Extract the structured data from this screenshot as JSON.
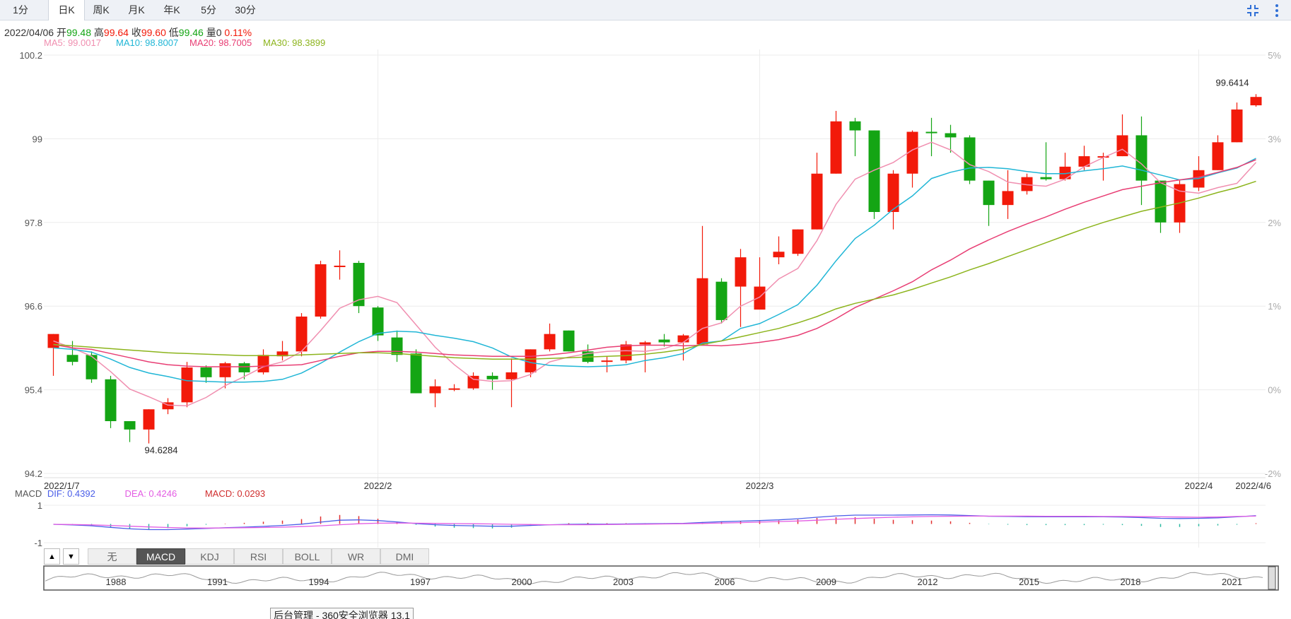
{
  "tabs": [
    "1分",
    "日K",
    "周K",
    "月K",
    "年K",
    "5分",
    "30分"
  ],
  "active_tab": "日K",
  "info": {
    "date": "2022/04/06",
    "open_label": "开",
    "open": "99.48",
    "high_label": "高",
    "high": "99.64",
    "close_label": "收",
    "close": "99.60",
    "low_label": "低",
    "low": "99.46",
    "vol_label": "量",
    "vol": "0",
    "change": "0.11%"
  },
  "ma": [
    {
      "label": "MA5: 99.0017",
      "color": "#f08fb0"
    },
    {
      "label": "MA10: 98.8007",
      "color": "#20b6d6"
    },
    {
      "label": "MA20: 98.7005",
      "color": "#e83e74"
    },
    {
      "label": "MA30: 98.3899",
      "color": "#8cb41c"
    }
  ],
  "macd_legend": {
    "name": "MACD",
    "dif": "DIF: 0.4392",
    "dea": "DEA: 0.4246",
    "macd": "MACD: 0.0293"
  },
  "indicator_tabs": [
    "无",
    "MACD",
    "KDJ",
    "RSI",
    "BOLL",
    "WR",
    "DMI"
  ],
  "active_indicator": "MACD",
  "arrows": {
    "up": "▲",
    "down": "▼"
  },
  "navigator_years": [
    "1988",
    "1991",
    "1994",
    "1997",
    "2000",
    "2003",
    "2006",
    "2009",
    "2012",
    "2015",
    "2018",
    "2021"
  ],
  "tooltip": "后台管理 - 360安全浏览器 13.1",
  "colors": {
    "up": "#f21a0a",
    "down": "#14a514",
    "dif": "#4a5ee8",
    "dea": "#e35ce3",
    "hist_up": "#e03030",
    "hist_down": "#2ab8a0"
  },
  "chart_data": {
    "type": "candlestick",
    "y_ticks": [
      "100.2",
      "99",
      "97.8",
      "96.6",
      "95.4",
      "94.2"
    ],
    "ylim": [
      94.2,
      100.2
    ],
    "pct_ticks": [
      "5%",
      "3%",
      "2%",
      "1%",
      "0%",
      "-2%"
    ],
    "x_labels": [
      {
        "label": "2022/1/7",
        "index": 0
      },
      {
        "label": "2022/2",
        "index": 17
      },
      {
        "label": "2022/3",
        "index": 37
      },
      {
        "label": "2022/4",
        "index": 60
      },
      {
        "label": "2022/4/6",
        "index": 63
      }
    ],
    "annotations": [
      {
        "label": "94.6284",
        "index": 5
      },
      {
        "label": "99.6414",
        "index": 63
      }
    ],
    "candles": [
      [
        96.0,
        96.2,
        96.2,
        95.6
      ],
      [
        95.9,
        95.8,
        96.1,
        95.75
      ],
      [
        95.9,
        95.55,
        95.95,
        95.5
      ],
      [
        95.55,
        94.95,
        95.6,
        94.85
      ],
      [
        94.95,
        94.83,
        94.95,
        94.65
      ],
      [
        94.83,
        95.12,
        95.12,
        94.63
      ],
      [
        95.12,
        95.22,
        95.28,
        95.05
      ],
      [
        95.22,
        95.72,
        95.8,
        95.15
      ],
      [
        95.72,
        95.58,
        95.75,
        95.5
      ],
      [
        95.58,
        95.78,
        95.8,
        95.42
      ],
      [
        95.78,
        95.65,
        95.8,
        95.55
      ],
      [
        95.65,
        95.9,
        95.98,
        95.62
      ],
      [
        95.88,
        95.95,
        96.1,
        95.82
      ],
      [
        95.95,
        96.45,
        96.5,
        95.88
      ],
      [
        96.45,
        97.2,
        97.25,
        96.42
      ],
      [
        97.18,
        97.18,
        97.4,
        96.98
      ],
      [
        97.22,
        96.6,
        97.25,
        96.5
      ],
      [
        96.58,
        96.18,
        96.6,
        96.1
      ],
      [
        96.15,
        95.9,
        96.25,
        95.8
      ],
      [
        95.92,
        95.35,
        95.98,
        95.35
      ],
      [
        95.35,
        95.45,
        95.55,
        95.15
      ],
      [
        95.42,
        95.42,
        95.48,
        95.38
      ],
      [
        95.42,
        95.6,
        95.65,
        95.4
      ],
      [
        95.6,
        95.55,
        95.65,
        95.4
      ],
      [
        95.55,
        95.65,
        95.85,
        95.15
      ],
      [
        95.65,
        95.98,
        95.98,
        95.58
      ],
      [
        95.98,
        96.2,
        96.35,
        95.95
      ],
      [
        96.25,
        95.95,
        96.25,
        95.95
      ],
      [
        95.95,
        95.8,
        96.05,
        95.78
      ],
      [
        95.8,
        95.82,
        95.88,
        95.65
      ],
      [
        95.82,
        96.05,
        96.1,
        95.78
      ],
      [
        96.05,
        96.08,
        96.1,
        95.65
      ],
      [
        96.12,
        96.08,
        96.2,
        96.02
      ],
      [
        96.08,
        96.18,
        96.2,
        95.82
      ],
      [
        96.05,
        97.0,
        97.75,
        96.05
      ],
      [
        96.95,
        96.4,
        97.0,
        96.35
      ],
      [
        96.88,
        97.3,
        97.42,
        96.3
      ],
      [
        96.55,
        96.88,
        97.3,
        96.8
      ],
      [
        97.3,
        97.38,
        97.6,
        97.2
      ],
      [
        97.35,
        97.7,
        97.7,
        97.32
      ],
      [
        97.7,
        98.5,
        98.8,
        97.7
      ],
      [
        98.5,
        99.25,
        99.4,
        98.5
      ],
      [
        99.25,
        99.12,
        99.3,
        98.75
      ],
      [
        99.12,
        97.95,
        99.12,
        97.85
      ],
      [
        97.95,
        98.5,
        98.55,
        97.7
      ],
      [
        98.5,
        99.1,
        99.12,
        98.3
      ],
      [
        99.1,
        99.08,
        99.3,
        98.75
      ],
      [
        99.08,
        99.02,
        99.2,
        98.8
      ],
      [
        99.02,
        98.4,
        99.05,
        98.35
      ],
      [
        98.4,
        98.05,
        98.4,
        97.75
      ],
      [
        98.05,
        98.25,
        98.55,
        97.85
      ],
      [
        98.25,
        98.45,
        98.5,
        98.2
      ],
      [
        98.45,
        98.42,
        98.95,
        98.4
      ],
      [
        98.42,
        98.6,
        98.8,
        98.4
      ],
      [
        98.6,
        98.75,
        98.9,
        98.55
      ],
      [
        98.75,
        98.75,
        98.8,
        98.4
      ],
      [
        98.75,
        99.05,
        99.35,
        98.75
      ],
      [
        99.05,
        98.4,
        99.32,
        98.05
      ],
      [
        98.4,
        97.8,
        98.4,
        97.65
      ],
      [
        97.8,
        98.35,
        98.4,
        97.65
      ],
      [
        98.3,
        98.55,
        98.75,
        98.25
      ],
      [
        98.55,
        98.95,
        99.05,
        98.55
      ],
      [
        98.95,
        99.42,
        99.52,
        98.95
      ],
      [
        99.48,
        99.6,
        99.64,
        99.46
      ]
    ],
    "ma5": [
      96.1,
      96.0,
      95.88,
      95.66,
      95.41,
      95.3,
      95.18,
      95.17,
      95.29,
      95.46,
      95.59,
      95.73,
      95.8,
      95.95,
      96.25,
      96.57,
      96.69,
      96.74,
      96.65,
      96.33,
      96.01,
      95.76,
      95.55,
      95.52,
      95.53,
      95.62,
      95.8,
      95.87,
      95.92,
      95.95,
      95.96,
      95.95,
      95.99,
      96.08,
      96.28,
      96.36,
      96.6,
      96.73,
      96.99,
      97.14,
      97.54,
      98.06,
      98.42,
      98.55,
      98.66,
      98.84,
      98.95,
      98.84,
      98.63,
      98.53,
      98.38,
      98.34,
      98.32,
      98.42,
      98.6,
      98.73,
      98.85,
      98.64,
      98.37,
      98.25,
      98.22,
      98.3,
      98.36,
      98.66
    ],
    "ma10": [
      96.0,
      95.98,
      95.94,
      95.84,
      95.72,
      95.64,
      95.59,
      95.53,
      95.52,
      95.51,
      95.51,
      95.52,
      95.55,
      95.64,
      95.78,
      95.94,
      96.09,
      96.21,
      96.24,
      96.23,
      96.18,
      96.14,
      96.09,
      96.0,
      95.87,
      95.79,
      95.75,
      95.74,
      95.73,
      95.74,
      95.76,
      95.82,
      95.86,
      95.92,
      96.07,
      96.1,
      96.28,
      96.35,
      96.48,
      96.62,
      96.9,
      97.25,
      97.57,
      97.76,
      97.99,
      98.18,
      98.43,
      98.52,
      98.58,
      98.59,
      98.57,
      98.53,
      98.5,
      98.5,
      98.54,
      98.57,
      98.61,
      98.55,
      98.48,
      98.41,
      98.43,
      98.51,
      98.58,
      98.72
    ],
    "ma20": [
      96.05,
      96.0,
      95.98,
      95.92,
      95.86,
      95.8,
      95.76,
      95.74,
      95.73,
      95.73,
      95.73,
      95.74,
      95.75,
      95.76,
      95.82,
      95.88,
      95.93,
      95.95,
      95.95,
      95.94,
      95.92,
      95.9,
      95.89,
      95.88,
      95.88,
      95.88,
      95.9,
      95.93,
      95.97,
      96.01,
      96.03,
      96.04,
      96.04,
      96.03,
      96.04,
      96.03,
      96.05,
      96.08,
      96.12,
      96.18,
      96.28,
      96.42,
      96.58,
      96.7,
      96.82,
      96.95,
      97.12,
      97.26,
      97.42,
      97.55,
      97.67,
      97.78,
      97.88,
      97.99,
      98.09,
      98.18,
      98.27,
      98.32,
      98.37,
      98.41,
      98.45,
      98.52,
      98.59,
      98.7
    ],
    "ma30": [
      96.05,
      96.03,
      96.01,
      95.99,
      95.97,
      95.95,
      95.93,
      95.92,
      95.91,
      95.9,
      95.89,
      95.89,
      95.89,
      95.9,
      95.91,
      95.92,
      95.93,
      95.93,
      95.92,
      95.9,
      95.88,
      95.86,
      95.85,
      95.84,
      95.84,
      95.84,
      95.85,
      95.86,
      95.87,
      95.88,
      95.89,
      95.91,
      95.94,
      95.98,
      96.05,
      96.1,
      96.16,
      96.22,
      96.28,
      96.36,
      96.45,
      96.56,
      96.64,
      96.7,
      96.76,
      96.84,
      96.93,
      97.02,
      97.12,
      97.21,
      97.31,
      97.41,
      97.51,
      97.61,
      97.71,
      97.8,
      97.88,
      97.96,
      98.02,
      98.08,
      98.15,
      98.23,
      98.3,
      98.39
    ],
    "macd": {
      "ylim": [
        -1,
        1
      ],
      "y_ticks": [
        "1",
        "-1"
      ],
      "dif": [
        -0.02,
        -0.05,
        -0.1,
        -0.18,
        -0.26,
        -0.3,
        -0.3,
        -0.27,
        -0.24,
        -0.2,
        -0.17,
        -0.13,
        -0.08,
        -0.01,
        0.1,
        0.2,
        0.22,
        0.18,
        0.11,
        0.02,
        -0.04,
        -0.08,
        -0.1,
        -0.12,
        -0.12,
        -0.08,
        -0.04,
        -0.02,
        -0.01,
        -0.01,
        -0.0,
        0.01,
        0.02,
        0.03,
        0.08,
        0.12,
        0.15,
        0.18,
        0.22,
        0.28,
        0.36,
        0.43,
        0.47,
        0.47,
        0.47,
        0.48,
        0.49,
        0.48,
        0.45,
        0.41,
        0.4,
        0.39,
        0.38,
        0.38,
        0.38,
        0.38,
        0.37,
        0.34,
        0.3,
        0.29,
        0.3,
        0.33,
        0.38,
        0.44
      ],
      "dea": [
        -0.02,
        -0.03,
        -0.05,
        -0.08,
        -0.12,
        -0.16,
        -0.19,
        -0.21,
        -0.22,
        -0.21,
        -0.2,
        -0.19,
        -0.17,
        -0.14,
        -0.1,
        -0.04,
        0.01,
        0.04,
        0.05,
        0.04,
        0.03,
        0.02,
        0.01,
        -0.0,
        -0.02,
        -0.03,
        -0.04,
        -0.04,
        -0.04,
        -0.03,
        -0.02,
        -0.01,
        -0.0,
        0.01,
        0.03,
        0.05,
        0.07,
        0.1,
        0.13,
        0.16,
        0.2,
        0.25,
        0.29,
        0.33,
        0.36,
        0.38,
        0.4,
        0.41,
        0.42,
        0.42,
        0.42,
        0.42,
        0.41,
        0.41,
        0.41,
        0.4,
        0.4,
        0.39,
        0.38,
        0.37,
        0.36,
        0.37,
        0.4,
        0.42
      ]
    }
  }
}
